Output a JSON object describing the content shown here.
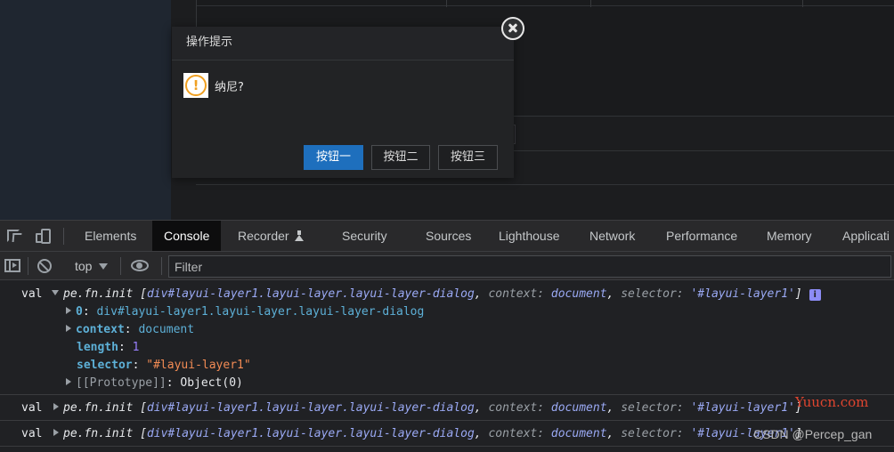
{
  "dialog": {
    "title": "操作提示",
    "message": "纳尼?",
    "buttons": [
      "按钮一",
      "按钮二",
      "按钮三"
    ]
  },
  "devtools": {
    "tabs": [
      "Elements",
      "Console",
      "Recorder",
      "Security",
      "Sources",
      "Lighthouse",
      "Network",
      "Performance",
      "Memory",
      "Applicati"
    ],
    "active_tab": "Console"
  },
  "console_toolbar": {
    "context": "top",
    "filter_placeholder": "Filter"
  },
  "console": {
    "messages": [
      {
        "prefix": "val",
        "summary_name": "pe.fn.init",
        "summary_element": "div#layui-layer1.layui-layer.layui-layer-dialog",
        "context_label": "context:",
        "context_value": "document",
        "selector_label": "selector:",
        "selector_value": "'#layui-layer1'",
        "expanded": true,
        "info_glyph": "i",
        "properties": [
          {
            "key": "0",
            "value": "div#layui-layer1.layui-layer.layui-layer-dialog"
          },
          {
            "key": "context",
            "value": "document"
          },
          {
            "key": "length",
            "value": "1"
          },
          {
            "key": "selector",
            "value": "\"#layui-layer1\""
          },
          {
            "key": "[[Prototype]]",
            "value": "Object(0)"
          }
        ]
      },
      {
        "prefix": "val",
        "summary_name": "pe.fn.init",
        "summary_element": "div#layui-layer1.layui-layer.layui-layer-dialog",
        "context_label": "context:",
        "context_value": "document",
        "selector_label": "selector:",
        "selector_value": "'#layui-layer1'",
        "expanded": false
      },
      {
        "prefix": "val",
        "summary_name": "pe.fn.init",
        "summary_element": "div#layui-layer1.layui-layer.layui-layer-dialog",
        "context_label": "context:",
        "context_value": "document",
        "selector_label": "selector:",
        "selector_value": "'#layui-layer1'",
        "expanded": false
      }
    ]
  },
  "watermarks": {
    "site": "Yuucn.com",
    "credit": "CSDN @Percep_gan"
  }
}
